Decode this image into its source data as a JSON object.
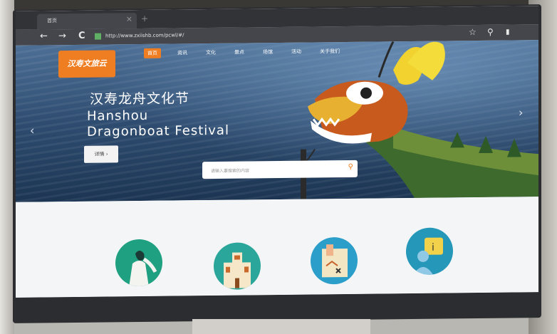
{
  "browser": {
    "tab_title": "首页",
    "tab_close": "×",
    "new_tab": "+",
    "url": "http://www.zxiishb.com/pcwl/#/",
    "nav": {
      "back": "←",
      "forward": "→",
      "reload": "C"
    },
    "tools": {
      "star": "☆",
      "search": "⚲",
      "bookmark": "▮"
    }
  },
  "site": {
    "logo": "汉寿文旅云",
    "menu": [
      "首页",
      "资讯",
      "文化",
      "景点",
      "场馆",
      "活动",
      "关于我们"
    ],
    "active_menu": "首页",
    "hero": {
      "title_cn": "汉寿龙舟文化节",
      "title_en_line1": "Hanshou",
      "title_en_line2": "Dragonboat Festival",
      "detail_button": "详情 ›",
      "prev": "‹",
      "next": "›"
    },
    "search": {
      "placeholder": "请输入要搜索的内容",
      "icon": "search-icon"
    }
  },
  "colors": {
    "accent": "#ef7d22",
    "browser_chrome": "#45464b"
  }
}
